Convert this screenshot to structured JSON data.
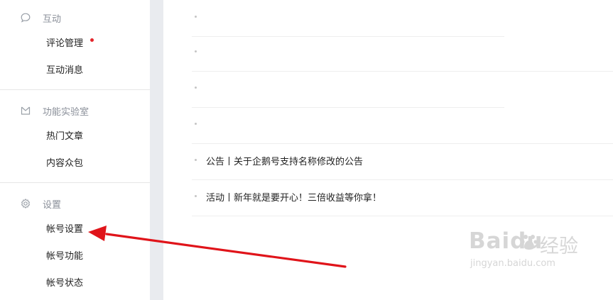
{
  "sidebar": {
    "sections": [
      {
        "title": "互动",
        "icon": "chat-bubble-icon",
        "items": [
          {
            "label": "评论管理",
            "badge": true
          },
          {
            "label": "互动消息"
          }
        ]
      },
      {
        "title": "功能实验室",
        "icon": "lab-tray-icon",
        "items": [
          {
            "label": "热门文章"
          },
          {
            "label": "内容众包"
          }
        ]
      },
      {
        "title": "设置",
        "icon": "gear-icon",
        "items": [
          {
            "label": "帐号设置"
          },
          {
            "label": "帐号功能"
          },
          {
            "label": "帐号状态"
          }
        ]
      }
    ]
  },
  "notices": [
    {
      "text": ""
    },
    {
      "text": ""
    },
    {
      "text": ""
    },
    {
      "text": ""
    },
    {
      "text": "公告丨关于企鹅号支持名称修改的公告"
    },
    {
      "text": "活动丨新年就是要开心！三倍收益等你拿！"
    }
  ],
  "annotation": {
    "arrow_color": "#e0141a",
    "target": "帐号设置"
  },
  "watermark": {
    "brand": "Baidu",
    "cn": "经验",
    "url": "jingyan.baidu.com"
  },
  "colors": {
    "badge": "#e4262b",
    "gutter": "#e9ebef"
  }
}
